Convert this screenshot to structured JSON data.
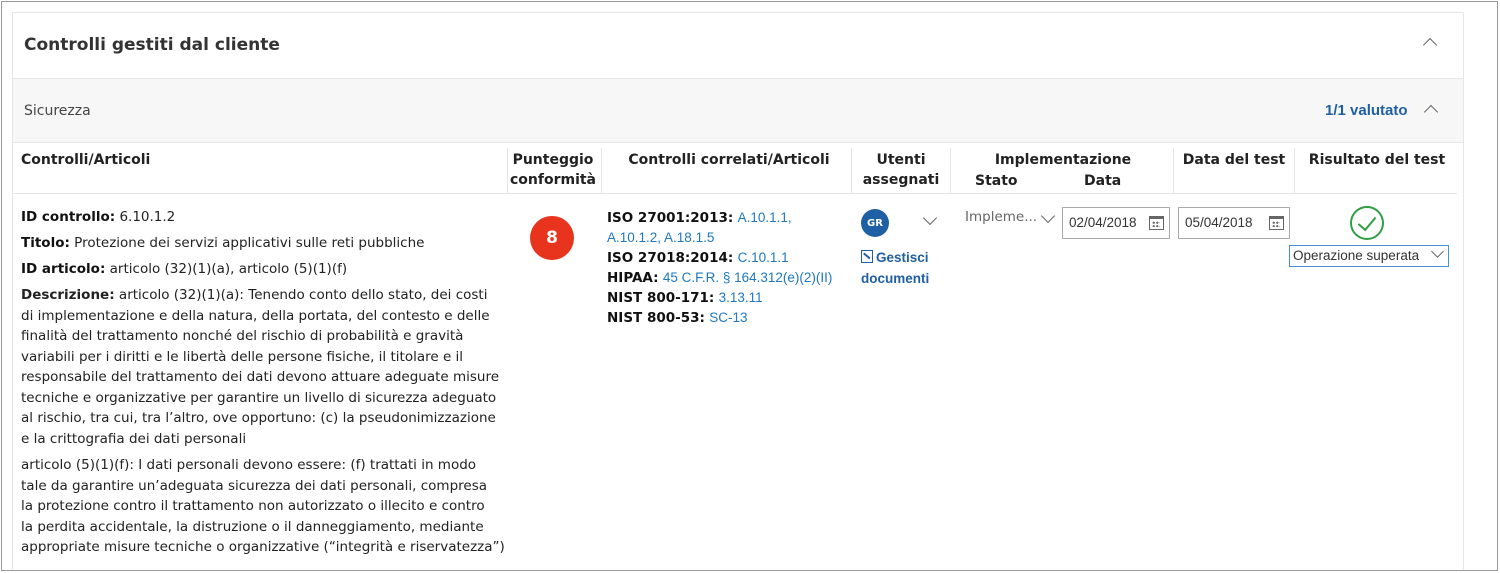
{
  "panel": {
    "title": "Controlli gestiti dal cliente"
  },
  "section": {
    "name": "Sicurezza",
    "assessed": "1/1 valutato"
  },
  "columns": {
    "controls": "Controlli/Articoli",
    "score_line1": "Punteggio",
    "score_line2": "conformità",
    "related": "Controlli correlati/Articoli",
    "users_line1": "Utenti",
    "users_line2": "assegnati",
    "implementation": "Implementazione",
    "impl_status": "Stato",
    "impl_date": "Data",
    "test_date": "Data del test",
    "test_result": "Risultato del test"
  },
  "control": {
    "id_label": "ID controllo:",
    "id_value": "6.10.1.2",
    "title_label": "Titolo:",
    "title_value": "Protezione dei servizi applicativi sulle reti pubbliche",
    "article_label": "ID articolo:",
    "article_value": "articolo (32)(1)(a), articolo (5)(1)(f)",
    "description_label": "Descrizione:",
    "description_lines": [
      "articolo (32)(1)(a): Tenendo conto dello stato, dei costi",
      "di implementazione e della natura, della portata, del contesto e delle",
      "finalità del trattamento nonché del rischio di probabilità e gravità",
      "variabili per i diritti e le libertà delle persone fisiche, il titolare e il",
      "responsabile del trattamento dei dati devono attuare adeguate misure",
      "tecniche e organizzative per garantire un livello di sicurezza adeguato",
      "al rischio, tra cui, tra l’altro, ove opportuno: (c) la pseudonimizzazione",
      "e la crittografia dei dati personali"
    ],
    "description2_lines": [
      "articolo (5)(1)(f): I dati personali devono essere: (f) trattati in modo",
      "tale da garantire un’adeguata sicurezza dei dati personali, compresa",
      "la protezione contro il trattamento non autorizzato o illecito e contro",
      "la perdita accidentale, la distruzione o il danneggiamento, mediante",
      "appropriate misure tecniche o organizzative (“integrità e riservatezza”)"
    ],
    "score": "8",
    "related": [
      {
        "standard": "ISO 27001:2013:",
        "refs": "A.10.1.1, A.10.1.2, A.18.1.5"
      },
      {
        "standard": "ISO 27018:2014:",
        "refs": "C.10.1.1"
      },
      {
        "standard": "HIPAA:",
        "refs": "45 C.F.R. § 164.312(e)(2)(II)"
      },
      {
        "standard": "NIST 800-171:",
        "refs": "3.13.11"
      },
      {
        "standard": "NIST 800-53:",
        "refs": "SC-13"
      }
    ],
    "assigned_user_initials": "GR",
    "manage_docs_line1": "Gestisci",
    "manage_docs_line2": "documenti",
    "impl_status": "Impleme...",
    "impl_date": "02/04/2018",
    "test_date": "05/04/2018",
    "test_result": "Operazione superata"
  },
  "colors": {
    "score_badge": "#e8341c",
    "link": "#1e78c2",
    "avatar": "#1f5fa3",
    "pass": "#2f9e44"
  }
}
